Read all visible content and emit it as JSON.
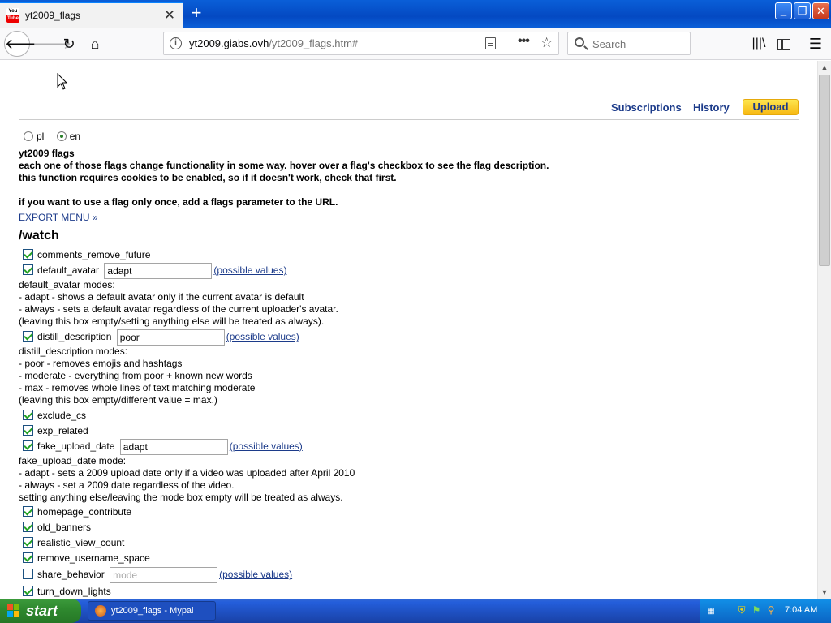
{
  "browser": {
    "tab_title": "yt2009_flags",
    "url_domain": "yt2009.giabs.ovh",
    "url_path": "/yt2009_flags.htm#",
    "search_placeholder": "Search"
  },
  "page": {
    "nav": {
      "subscriptions": "Subscriptions",
      "history": "History",
      "upload": "Upload"
    },
    "lang": {
      "pl": "pl",
      "en": "en",
      "selected": "en"
    },
    "intro": {
      "title": "yt2009 flags",
      "line1": "each one of those flags change functionality in some way. hover over a flag's checkbox to see the flag description.",
      "line2": "this function requires cookies to be enabled, so if it doesn't work, check that first.",
      "line3": "if you want to use a flag only once, add a flags parameter to the URL."
    },
    "export_menu": "EXPORT MENU »",
    "section_title": "/watch",
    "possible_values": "(possible values)",
    "flags": {
      "comments_remove_future": {
        "label": "comments_remove_future",
        "checked": true
      },
      "default_avatar": {
        "label": "default_avatar",
        "checked": true,
        "value": "adapt"
      },
      "distill_description": {
        "label": "distill_description",
        "checked": true,
        "value": "poor"
      },
      "exclude_cs": {
        "label": "exclude_cs",
        "checked": true
      },
      "exp_related": {
        "label": "exp_related",
        "checked": true
      },
      "fake_upload_date": {
        "label": "fake_upload_date",
        "checked": true,
        "value": "adapt"
      },
      "homepage_contribute": {
        "label": "homepage_contribute",
        "checked": true
      },
      "old_banners": {
        "label": "old_banners",
        "checked": true
      },
      "realistic_view_count": {
        "label": "realistic_view_count",
        "checked": true
      },
      "remove_username_space": {
        "label": "remove_username_space",
        "checked": true
      },
      "share_behavior": {
        "label": "share_behavior",
        "checked": false,
        "value": "",
        "placeholder": "mode"
      },
      "turn_down_lights": {
        "label": "turn_down_lights",
        "checked": true
      }
    },
    "descriptions": {
      "default_avatar": [
        "default_avatar modes:",
        "- adapt - shows a default avatar only if the current avatar is default",
        "- always - sets a default avatar regardless of the current uploader's avatar.",
        "(leaving this box empty/setting anything else will be treated as always)."
      ],
      "distill_description": [
        "distill_description modes:",
        "- poor - removes emojis and hashtags",
        "- moderate - everything from poor + known new words",
        "- max - removes whole lines of text matching moderate",
        "(leaving this box empty/different value = max.)"
      ],
      "fake_upload_date": [
        "fake_upload_date mode:",
        "- adapt - sets a 2009 upload date only if a video was uploaded after April 2010",
        "- always - set a 2009 date regardless of the video.",
        "setting anything else/leaving the mode box empty will be treated as always."
      ]
    }
  },
  "taskbar": {
    "start": "start",
    "task_item": "yt2009_flags - Mypal",
    "clock": "7:04 AM"
  },
  "colors": {
    "link": "#1c3b8a",
    "upload_button": "#f7b812",
    "titlebar": "#0a5fd8",
    "taskbar": "#245edb",
    "start_button": "#2f8a2f"
  }
}
